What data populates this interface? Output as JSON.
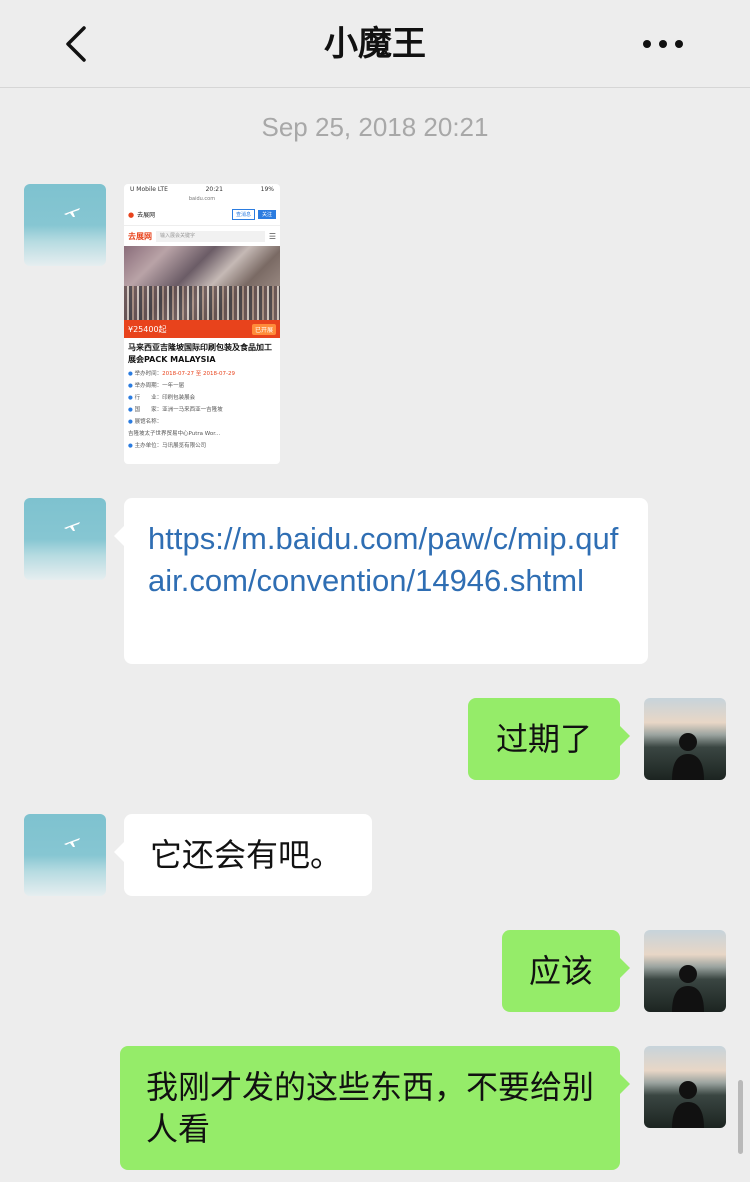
{
  "header": {
    "title": "小魔王",
    "back_icon": "chevron-left-icon",
    "more_icon": "more-dots-icon"
  },
  "timestamp": "Sep 25, 2018 20:21",
  "image_message": {
    "status_left": "U Mobile  LTE",
    "status_time": "20:21",
    "status_right": "19%",
    "url": "baidu.com",
    "site_name": "去展网",
    "btn_follow_outline": "查消息",
    "btn_follow": "关注",
    "search_logo": "去展网",
    "search_placeholder": "输入展会关键字",
    "price": "¥25400起",
    "price_tag": "已开展",
    "title": "马来西亚吉隆坡国际印刷包装及食品加工展会PACK MALAYSIA",
    "rows": [
      {
        "label": "举办时间：",
        "value": "2018-07-27 至 2018-07-29"
      },
      {
        "label": "举办周期：",
        "value": "一年一届"
      },
      {
        "label": "行　　业：",
        "value": "印刷包装展会"
      },
      {
        "label": "国　　家：",
        "value": "亚洲一马来西亚一吉隆坡"
      },
      {
        "label": "展馆名称：",
        "value": ""
      },
      {
        "label": "",
        "value": "吉隆坡太子世界贸易中心Putra Wor..."
      },
      {
        "label": "主办单位：",
        "value": "马讯展览有限公司"
      }
    ]
  },
  "messages": {
    "link": "https://m.baidu.com/paw/c/mip.qufair.com/convention/14946.shtml",
    "m1": "过期了",
    "m2": "它还会有吧。",
    "m3": "应该",
    "m4": "我刚才发的这些东西，不要给别人看"
  }
}
